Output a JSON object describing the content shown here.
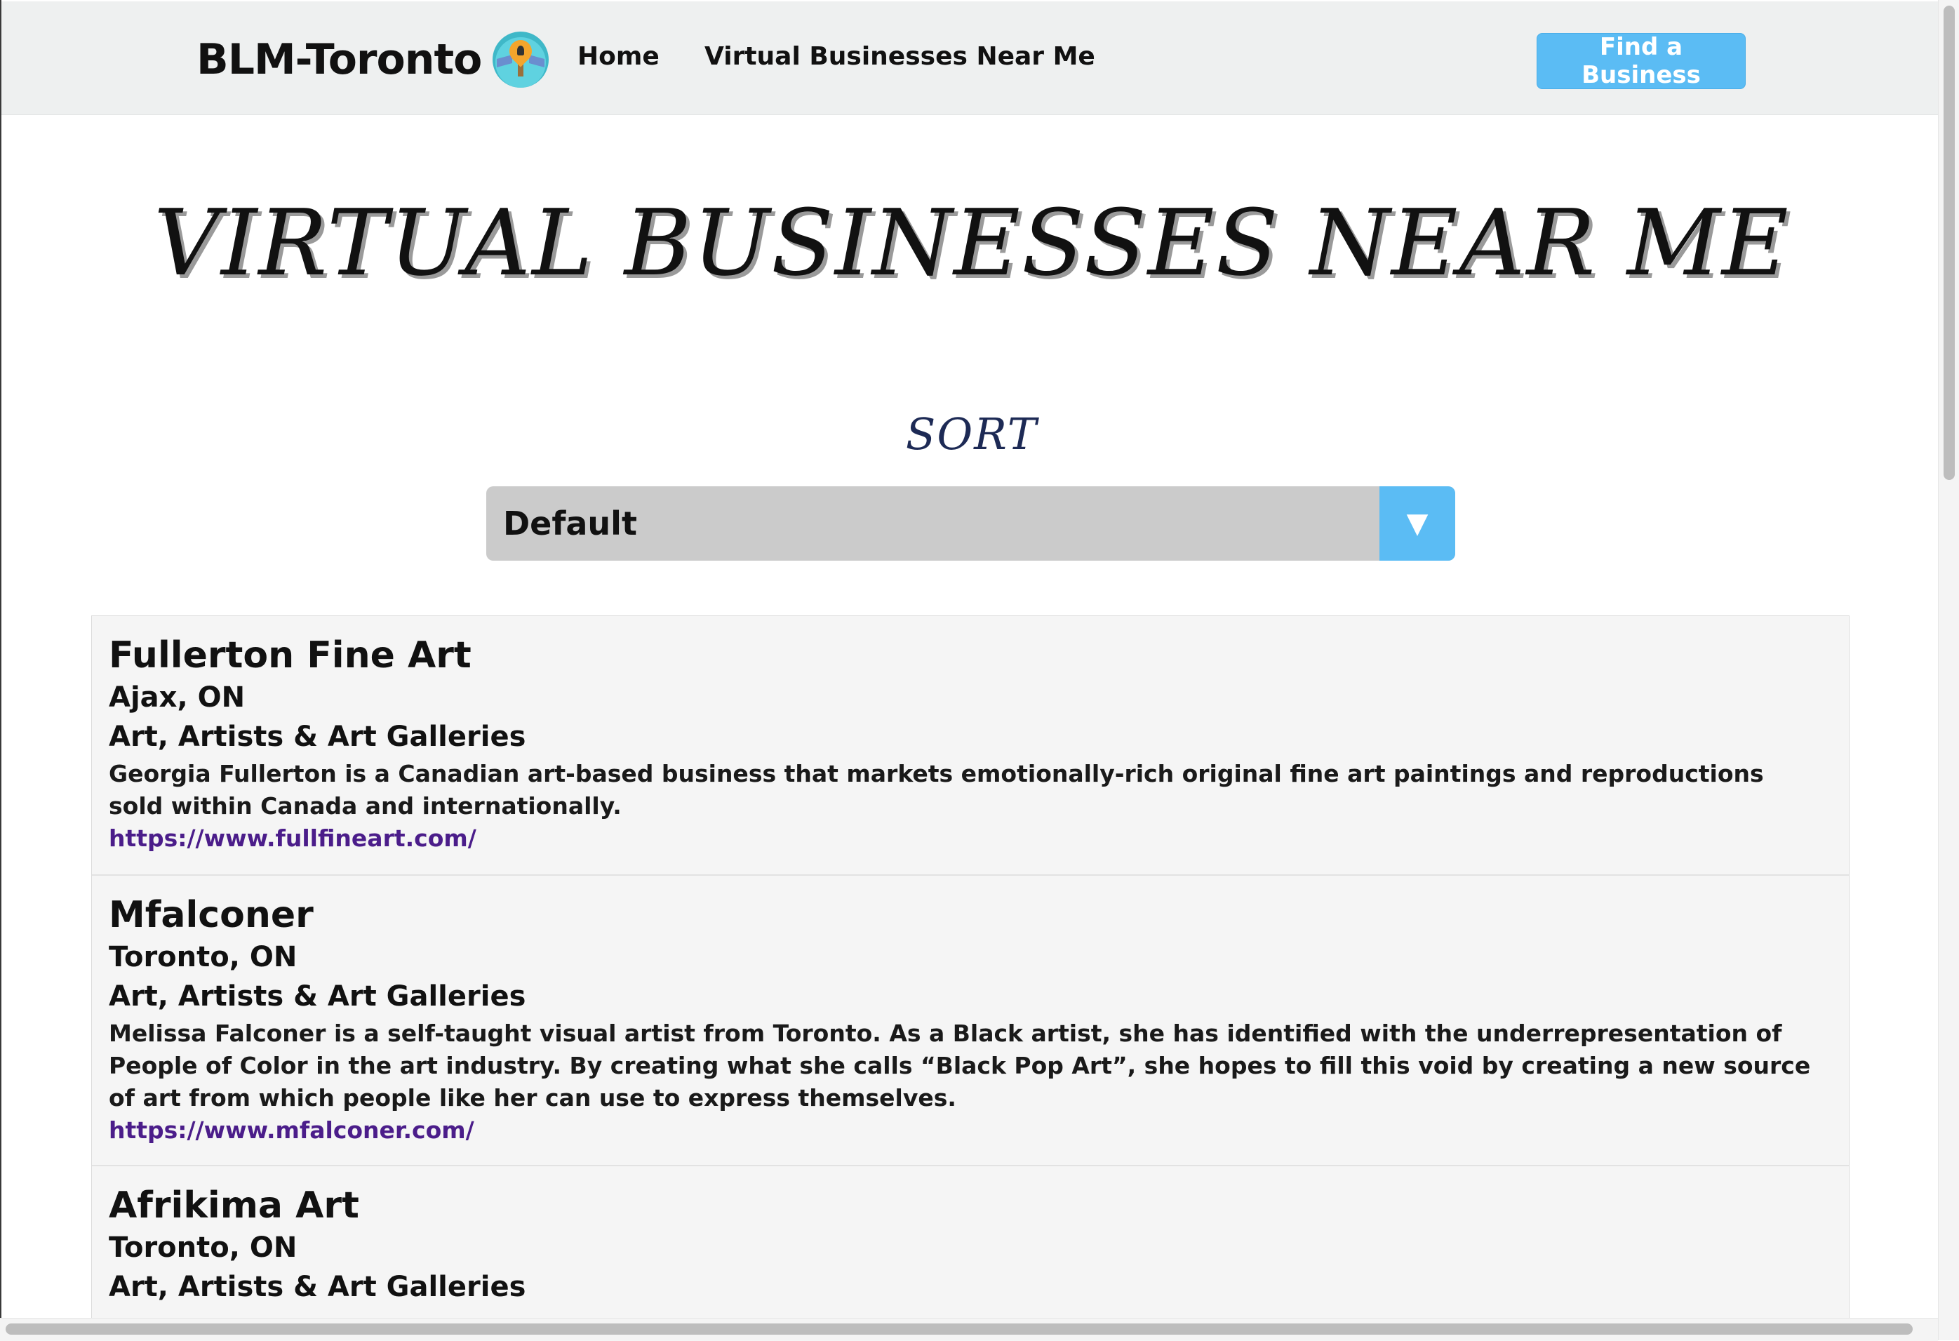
{
  "navbar": {
    "brand": "BLM-Toronto",
    "links": [
      "Home",
      "Virtual Businesses Near Me"
    ],
    "cta": "Find a Business"
  },
  "main": {
    "title": "VIRTUAL BUSINESSES NEAR ME",
    "sort_label": "SORT",
    "sort_value": "Default",
    "sort_arrow": "▼"
  },
  "businesses": [
    {
      "name": "Fullerton Fine Art",
      "city": "Ajax, ON",
      "category": "Art, Artists & Art Galleries",
      "description": "Georgia Fullerton is a Canadian art-based business that markets emotionally-rich original fine art paintings and reproductions sold within Canada and internationally.",
      "url": "https://www.fullfineart.com/"
    },
    {
      "name": "Mfalconer",
      "city": "Toronto, ON",
      "category": "Art, Artists & Art Galleries",
      "description": "Melissa Falconer is a self-taught visual artist from Toronto. As a Black artist, she has identified with the underrepresentation of People of Color in the art industry. By creating what she calls “Black Pop Art”, she hopes to fill this void by creating a new source of art from which people like her can use to express themselves.",
      "url": "https://www.mfalconer.com/"
    },
    {
      "name": "Afrikima Art",
      "city": "Toronto, ON",
      "category": "Art, Artists & Art Galleries"
    }
  ]
}
